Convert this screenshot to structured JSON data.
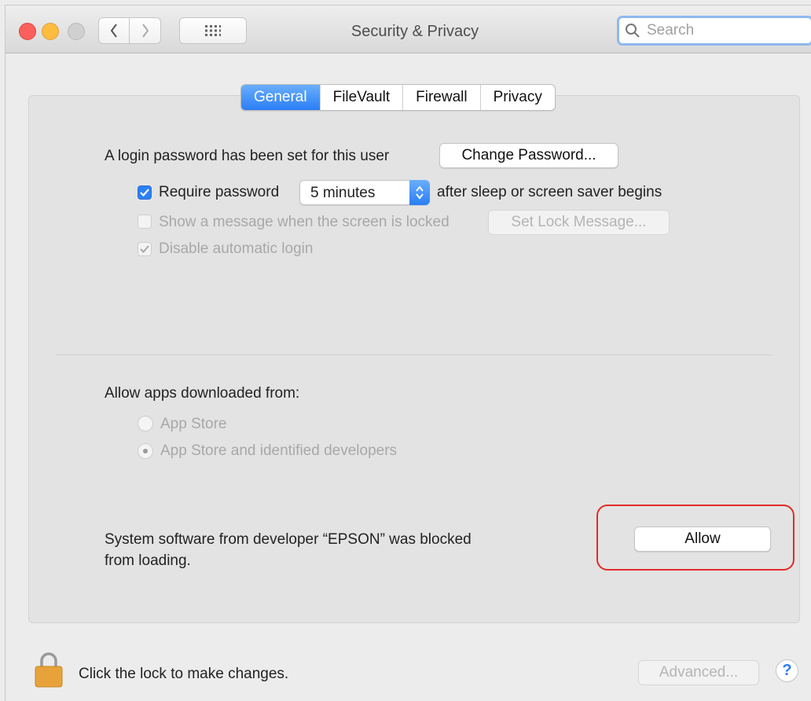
{
  "window": {
    "title": "Security & Privacy"
  },
  "search": {
    "placeholder": "Search"
  },
  "tabs": [
    {
      "label": "General",
      "active": true
    },
    {
      "label": "FileVault",
      "active": false
    },
    {
      "label": "Firewall",
      "active": false
    },
    {
      "label": "Privacy",
      "active": false
    }
  ],
  "general": {
    "login_password_text": "A login password has been set for this user",
    "change_password_label": "Change Password...",
    "require_password_label": "Require password",
    "require_password_checked": true,
    "require_password_delay": "5 minutes",
    "after_sleep_text": "after sleep or screen saver begins",
    "show_message_label": "Show a message when the screen is locked",
    "show_message_checked": false,
    "set_lock_message_label": "Set Lock Message...",
    "disable_auto_login_label": "Disable automatic login",
    "disable_auto_login_checked": true,
    "allow_apps_heading": "Allow apps downloaded from:",
    "radio_app_store": "App Store",
    "radio_identified": "App Store and identified developers",
    "selected_radio": "App Store and identified developers",
    "blocked_text_line1": "System software from developer “EPSON” was blocked",
    "blocked_text_line2": "from loading.",
    "allow_button_label": "Allow"
  },
  "footer": {
    "lock_text": "Click the lock to make changes.",
    "advanced_label": "Advanced...",
    "help_label": "?"
  },
  "colors": {
    "accent": "#2a7ef5",
    "highlight": "#e52a2a",
    "close": "#fc605c",
    "minimize": "#fdbc40",
    "lock": "#e8a23a"
  }
}
